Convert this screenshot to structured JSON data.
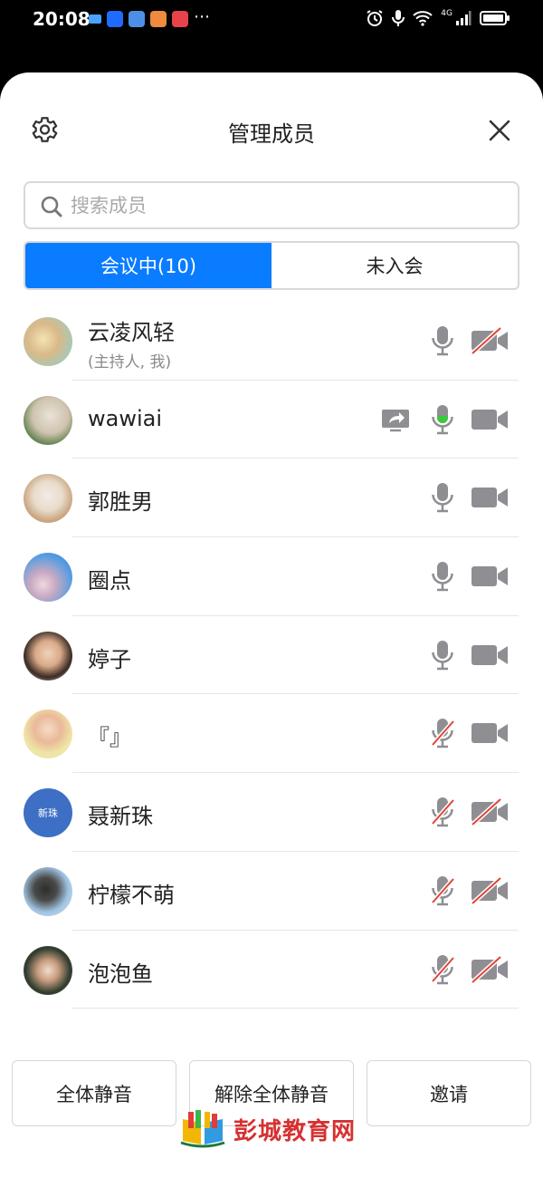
{
  "status_bar": {
    "time": "20:08",
    "network": "4G"
  },
  "header": {
    "title": "管理成员"
  },
  "search": {
    "placeholder": "搜索成员"
  },
  "tabs": [
    {
      "label": "会议中(10)",
      "active": true
    },
    {
      "label": "未入会",
      "active": false
    }
  ],
  "members": [
    {
      "name": "云凌风轻",
      "role": "(主持人, 我)",
      "sharing": false,
      "mic": "on",
      "camera": "off"
    },
    {
      "name": "wawiai",
      "role": "",
      "sharing": true,
      "mic": "speaking",
      "camera": "on"
    },
    {
      "name": "郭胜男",
      "role": "",
      "sharing": false,
      "mic": "on",
      "camera": "on"
    },
    {
      "name": "圈点",
      "role": "",
      "sharing": false,
      "mic": "on",
      "camera": "on"
    },
    {
      "name": "婷子",
      "role": "",
      "sharing": false,
      "mic": "on",
      "camera": "on"
    },
    {
      "name": "『』",
      "role": "",
      "sharing": false,
      "mic": "off",
      "camera": "on"
    },
    {
      "name": "聂新珠",
      "role": "",
      "sharing": false,
      "mic": "off",
      "camera": "off",
      "avatar_text": "新珠"
    },
    {
      "name": "柠檬不萌",
      "role": "",
      "sharing": false,
      "mic": "off",
      "camera": "off"
    },
    {
      "name": "泡泡鱼",
      "role": "",
      "sharing": false,
      "mic": "off",
      "camera": "off"
    }
  ],
  "actions": {
    "mute_all": "全体静音",
    "unmute_all": "解除全体静音",
    "invite": "邀请"
  },
  "watermark": "彭城教育网",
  "colors": {
    "accent": "#0a7cff",
    "speaking": "#3cc83c",
    "muted_slash": "#e0443a",
    "icon_gray": "#8e8e93"
  }
}
